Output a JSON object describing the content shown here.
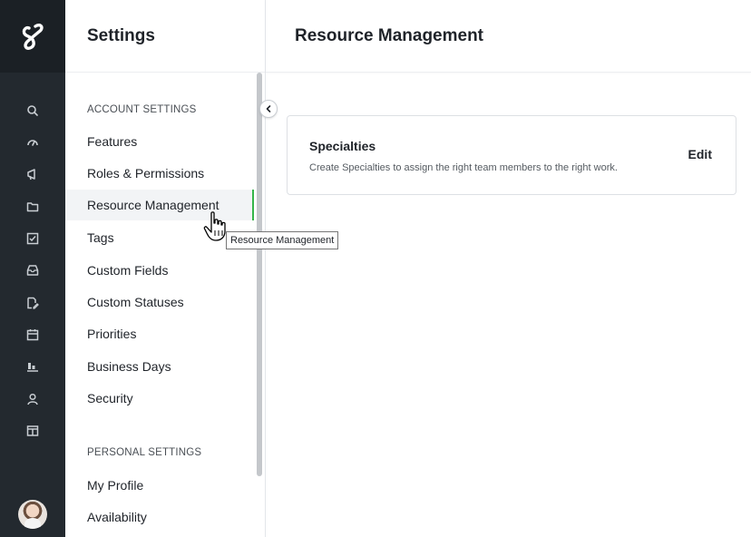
{
  "rail": {
    "logo_icon": "loop-logo-icon",
    "icons": [
      "search-icon",
      "dashboard-gauge-icon",
      "megaphone-icon",
      "folder-icon",
      "checkbox-icon",
      "inbox-icon",
      "document-edit-icon",
      "calendar-icon",
      "reports-chart-icon",
      "person-icon",
      "board-icon"
    ],
    "avatar": "user-avatar"
  },
  "settings": {
    "title": "Settings",
    "account_section_label": "ACCOUNT SETTINGS",
    "account_items": [
      {
        "label": "Features"
      },
      {
        "label": "Roles & Permissions"
      },
      {
        "label": "Resource Management",
        "active": true
      },
      {
        "label": "Tags"
      },
      {
        "label": "Custom Fields"
      },
      {
        "label": "Custom Statuses"
      },
      {
        "label": "Priorities"
      },
      {
        "label": "Business Days"
      },
      {
        "label": "Security"
      }
    ],
    "personal_section_label": "PERSONAL SETTINGS",
    "personal_items": [
      {
        "label": "My Profile"
      },
      {
        "label": "Availability"
      }
    ]
  },
  "main": {
    "title": "Resource Management",
    "card": {
      "title": "Specialties",
      "description": "Create Specialties to assign the right team members to the right work.",
      "edit_label": "Edit"
    }
  },
  "tooltip": {
    "text": "Resource Management"
  },
  "colors": {
    "rail_bg": "#23292f",
    "active_indicator": "#35b54a"
  }
}
